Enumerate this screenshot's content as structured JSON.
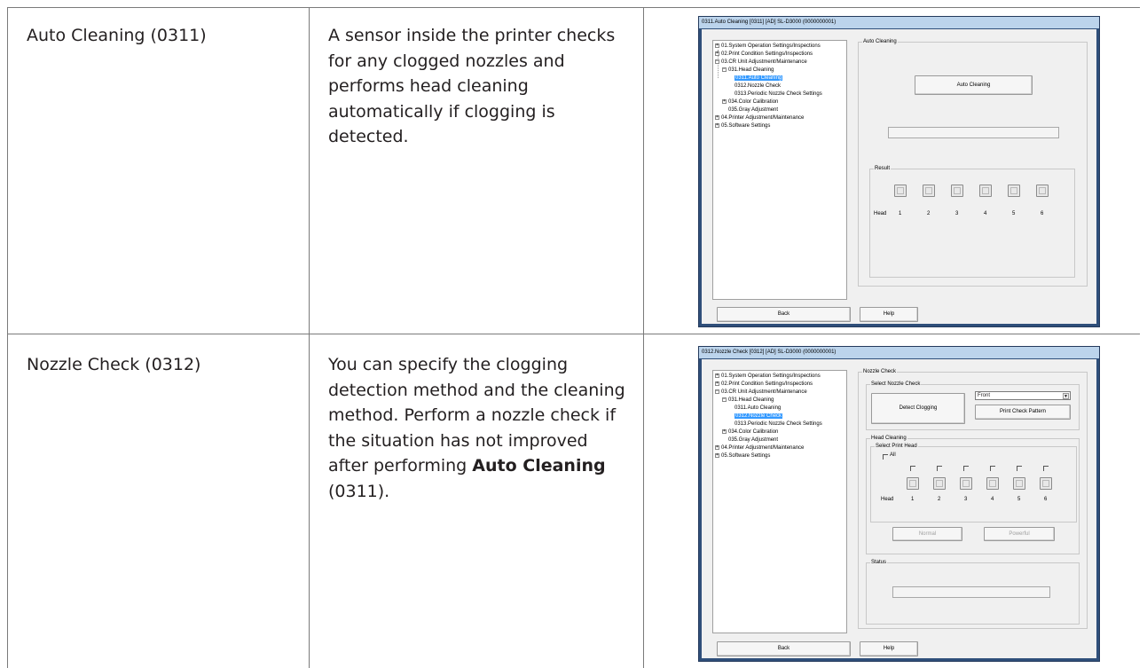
{
  "rows": [
    {
      "name": "Auto Cleaning (0311)",
      "description": "A sensor inside the printer checks for any clogged nozzles and performs head cleaning automatically if clogging is detected."
    },
    {
      "name": "Nozzle Check (0312)",
      "description_part1": "You can specify the clogging detection method and the cleaning method. Perform a nozzle check if the situation has not improved after performing",
      "description_bold": "Auto Cleaning",
      "description_part2": "(0311)."
    }
  ],
  "tree": {
    "items": [
      "01.System Operation Settings/Inspections",
      "02.Print Condition Settings/Inspections",
      "03.CR Unit Adjustment/Maintenance",
      "031.Head Cleaning",
      "0311.Auto Cleaning",
      "0312.Nozzle Check",
      "0313.Periodic Nozzle Check Settings",
      "034.Color Calibration",
      "035.Gray Adjustment",
      "04.Printer Adjustment/Maintenance",
      "05.Software Settings"
    ]
  },
  "screen1": {
    "title": "0311.Auto Cleaning  [0311]  [AD]  SL-D3000  (0000000001)",
    "group_label": "Auto Cleaning",
    "button": "Auto Cleaning",
    "result_label": "Result",
    "head_label": "Head",
    "heads": [
      "1",
      "2",
      "3",
      "4",
      "5",
      "6"
    ],
    "back": "Back",
    "help": "Help"
  },
  "screen2": {
    "title": "0312.Nozzle Check  [0312]  [AD]  SL-D3000  (0000000001)",
    "group_label": "Nozzle Check",
    "select_label": "Select Nozzle Check",
    "detect_button": "Detect Clogging",
    "dropdown_value": "Front",
    "print_button": "Print Check Pattern",
    "head_cleaning_label": "Head Cleaning",
    "select_head_label": "Select Print Head",
    "all_label": "All",
    "head_label": "Head",
    "heads": [
      "1",
      "2",
      "3",
      "4",
      "5",
      "6"
    ],
    "normal_button": "Normal",
    "powerful_button": "Powerful",
    "status_label": "Status",
    "back": "Back",
    "help": "Help"
  }
}
